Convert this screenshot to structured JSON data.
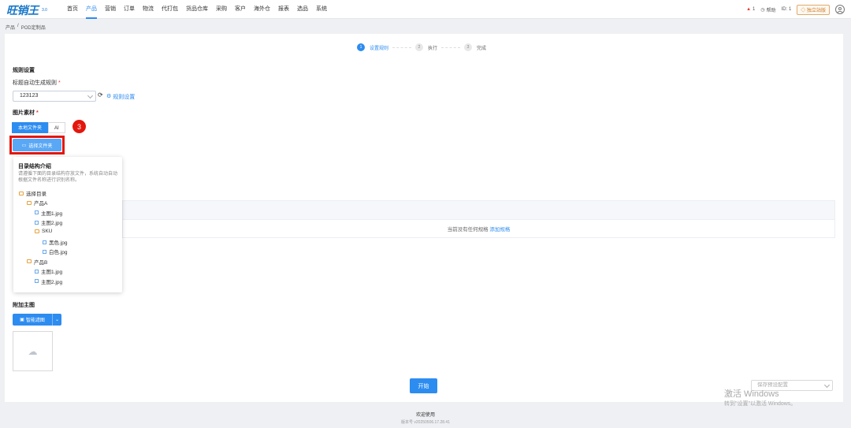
{
  "app": {
    "logo": "旺销王",
    "version": "3.0"
  },
  "nav": [
    {
      "label": "首页",
      "active": false
    },
    {
      "label": "产品",
      "active": true
    },
    {
      "label": "营销",
      "active": false
    },
    {
      "label": "订单",
      "active": false
    },
    {
      "label": "物流",
      "active": false
    },
    {
      "label": "代打包",
      "active": false
    },
    {
      "label": "货品仓库",
      "active": false
    },
    {
      "label": "采购",
      "active": false
    },
    {
      "label": "客户",
      "active": false
    },
    {
      "label": "海外仓",
      "active": false
    },
    {
      "label": "报表",
      "active": false
    },
    {
      "label": "选品",
      "active": false
    },
    {
      "label": "系统",
      "active": false
    }
  ],
  "header_right": {
    "warning_count": "1",
    "help": "帮助",
    "id_label": "ID: 1",
    "independent_site": "独立站版"
  },
  "breadcrumb": {
    "root": "产品",
    "separator": "/",
    "current": "POD定制品"
  },
  "steps": [
    {
      "num": "1",
      "label": "设置规则",
      "active": true
    },
    {
      "num": "2",
      "label": "执行",
      "active": false
    },
    {
      "num": "3",
      "label": "完成",
      "active": false
    }
  ],
  "rules": {
    "section_title": "规则设置",
    "title_rule_label": "标题自动生成规则",
    "required_mark": "*",
    "title_rule_value": "123123",
    "rule_settings_link": "规则设置"
  },
  "images": {
    "section_title": "图片素材",
    "tab_local": "本地文件夹",
    "tab_ai": "AI",
    "step_badge": "3",
    "choose_folder": "选择文件夹"
  },
  "popover": {
    "title": "目录结构介绍",
    "description": "请遵循下面的目录结构存放文件，系统自动自动根据文件名称进行识别名称。",
    "tree": [
      {
        "label": "选择目录",
        "type": "folder",
        "depth": 0
      },
      {
        "label": "产品A",
        "type": "folder",
        "depth": 1
      },
      {
        "label": "主图1.jpg",
        "type": "file",
        "depth": 2
      },
      {
        "label": "主图2.jpg",
        "type": "file",
        "depth": 2
      },
      {
        "label": "SKU",
        "type": "folder",
        "depth": 2
      },
      {
        "label": "黑色.jpg",
        "type": "file",
        "depth": 3
      },
      {
        "label": "白色.jpg",
        "type": "file",
        "depth": 3
      },
      {
        "label": "产品B",
        "type": "folder",
        "depth": 1
      },
      {
        "label": "主图1.jpg",
        "type": "file",
        "depth": 2
      },
      {
        "label": "主图2.jpg",
        "type": "file",
        "depth": 2
      }
    ]
  },
  "spec_table": {
    "empty_text": "当前没有任何规格",
    "add_link": "添加规格"
  },
  "extra_main_image": {
    "section_title": "附加主图",
    "smart_button": "智能滤图"
  },
  "actions": {
    "start": "开始",
    "save_placeholder": "保存预设配置"
  },
  "footer": {
    "title": "欢迎使用",
    "version": "版本号 v20250506.17.28.41"
  },
  "watermark": {
    "line1": "激活 Windows",
    "line2": "转到\"设置\"以激活 Windows。"
  },
  "colors": {
    "primary": "#2d8cf0",
    "highlight": "#e3170d",
    "warning": "#e53935"
  }
}
